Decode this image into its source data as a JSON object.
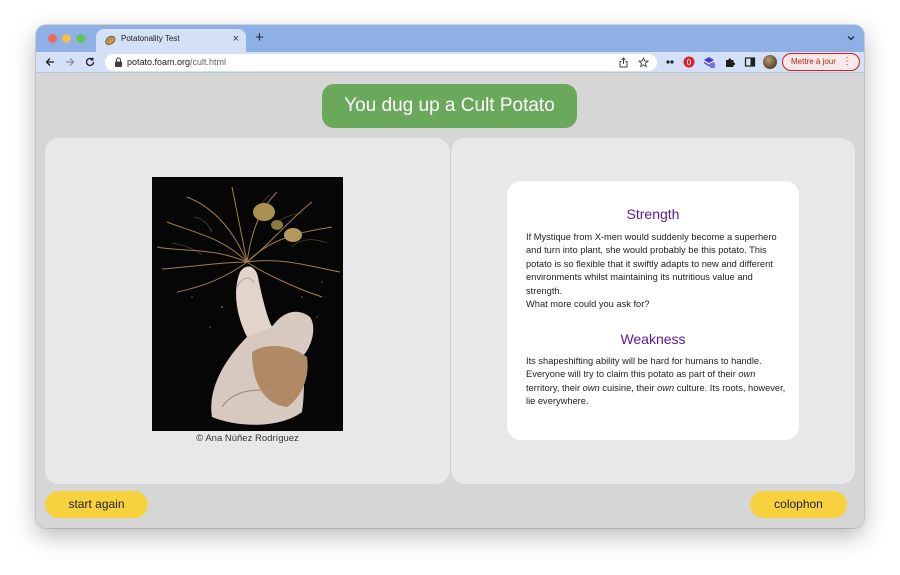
{
  "browser": {
    "tab_title": "Potatonality Test",
    "tab_close": "×",
    "new_tab": "+",
    "url_host": "potato.foam.org",
    "url_path": "/cult.html",
    "update_label": "Mettre à jour",
    "update_menu": "⋮"
  },
  "page": {
    "result_title": "You dug up a Cult Potato",
    "photo_credit": "© Ana Núñez Rodríguez",
    "strength": {
      "heading": "Strength",
      "line1": "If Mystique from X-men would suddenly become a superhero and turn into plant, she would probably be this potato. This potato is so flexible that it swiftly adapts to new and different environments whilst maintaining its nutritious value and strength.",
      "line2": "What more could you ask for?"
    },
    "weakness": {
      "heading": "Weakness",
      "part1": "Its shapeshifting ability will be hard for humans to handle. Everyone will try to claim this potato as part of their ",
      "own": "own",
      "part2": " territory, their ",
      "part3": " cuisine, their ",
      "part4": " culture. Its roots, however, lie everywhere."
    },
    "start_again": "start again",
    "colophon": "colophon"
  },
  "colors": {
    "accent_green": "#6aa85c",
    "heading_purple": "#5a189a",
    "button_yellow": "#f7d23e",
    "tab_strip": "#8fb0e4"
  }
}
